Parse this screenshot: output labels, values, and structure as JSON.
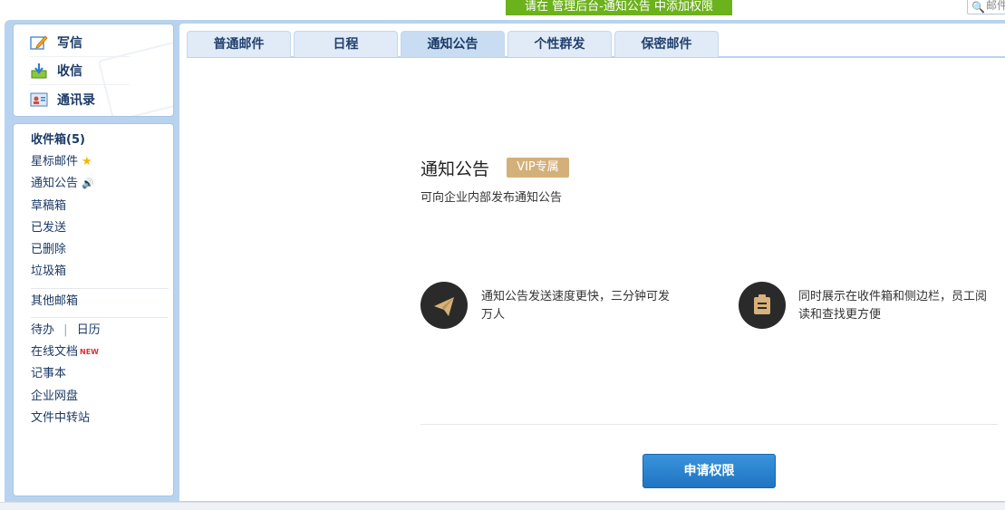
{
  "banner": {
    "text": "请在 管理后台-通知公告 中添加权限"
  },
  "search": {
    "placeholder": "邮件"
  },
  "actions": [
    {
      "label": "写信",
      "icon": "compose-icon"
    },
    {
      "label": "收信",
      "icon": "inbox-download-icon"
    },
    {
      "label": "通讯录",
      "icon": "contacts-icon"
    }
  ],
  "folders": {
    "inbox": "收件箱(5)",
    "starred": "星标邮件",
    "notice": "通知公告",
    "drafts": "草稿箱",
    "sent": "已发送",
    "deleted": "已删除",
    "spam": "垃圾箱",
    "other": "其他邮箱",
    "todo": "待办",
    "separator": "|",
    "calendar": "日历",
    "online_docs": "在线文档",
    "new_badge": "NEW",
    "notepad": "记事本",
    "netdisk": "企业网盘",
    "file_transfer": "文件中转站"
  },
  "tabs": [
    "普通邮件",
    "日程",
    "通知公告",
    "个性群发",
    "保密邮件"
  ],
  "active_tab": "通知公告",
  "notice": {
    "title": "通知公告",
    "vip": "VIP专属",
    "subtitle": "可向企业内部发布通知公告",
    "feature1": "通知公告发送速度更快，三分钟可发万人",
    "feature2": "同时展示在收件箱和侧边栏，员工阅读和查找更方便",
    "apply_button": "申请权限"
  },
  "colors": {
    "banner_green": "#6cb21c",
    "frame_blue": "#b8d3ef",
    "tab_bg": "#e0ebf7",
    "tab_active_bg": "#c8dcf2",
    "link_navy": "#1b3a66",
    "vip_gold": "#d3b07a",
    "button_blue": "#2a84d0",
    "feature_icon_bg": "#2a2a2a"
  }
}
